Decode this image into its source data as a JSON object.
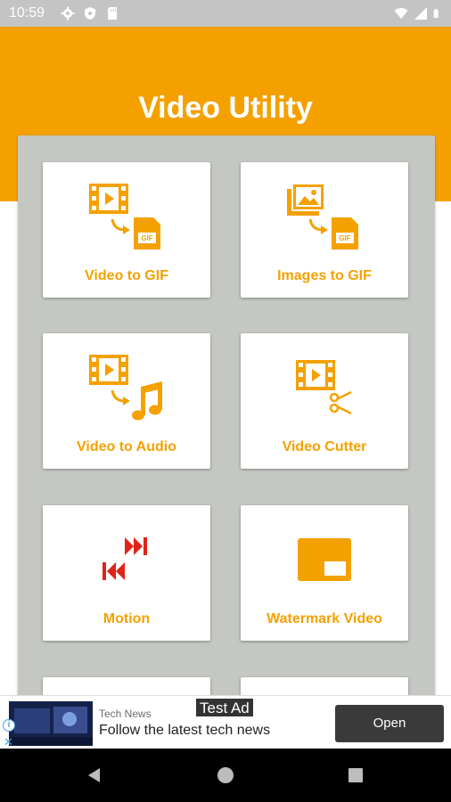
{
  "status_bar": {
    "time": "10:59",
    "icons_left": [
      "settings-icon",
      "shield-icon",
      "sd-card-icon"
    ],
    "icons_right": [
      "wifi-icon",
      "signal-icon",
      "battery-icon"
    ]
  },
  "header": {
    "title": "Video Utility",
    "color": "#f4a100"
  },
  "features": [
    {
      "label": "Video to GIF",
      "icon": "video-to-gif-icon"
    },
    {
      "label": "Images to GIF",
      "icon": "images-to-gif-icon"
    },
    {
      "label": "Video to Audio",
      "icon": "video-to-audio-icon"
    },
    {
      "label": "Video Cutter",
      "icon": "video-cutter-icon"
    },
    {
      "label": "Motion",
      "icon": "motion-icon"
    },
    {
      "label": "Watermark Video",
      "icon": "watermark-icon"
    }
  ],
  "ad": {
    "badge": "Test Ad",
    "source": "Tech News",
    "headline": "Follow the latest tech news",
    "button_label": "Open"
  },
  "nav": {
    "buttons": [
      "back-icon",
      "home-icon",
      "recents-icon"
    ]
  }
}
